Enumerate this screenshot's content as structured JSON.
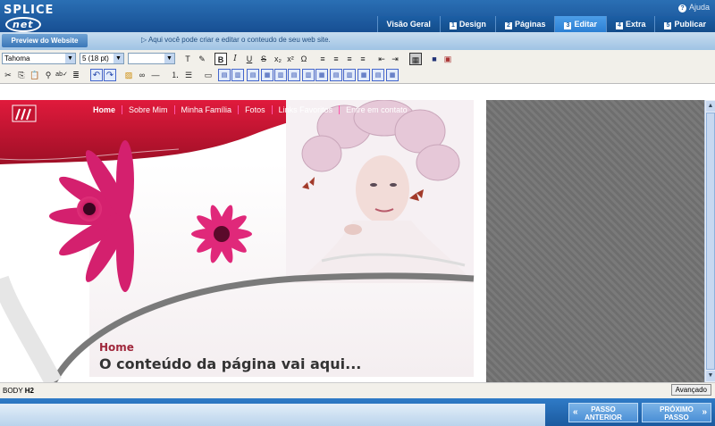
{
  "app": {
    "logo": "SPLICE",
    "logo_suffix": "net",
    "help_label": "Ajuda"
  },
  "tabs": [
    {
      "num": "",
      "label": "Visão Geral"
    },
    {
      "num": "1",
      "label": "Design"
    },
    {
      "num": "2",
      "label": "Páginas"
    },
    {
      "num": "3",
      "label": "Editar"
    },
    {
      "num": "4",
      "label": "Extra"
    },
    {
      "num": "5",
      "label": "Publicar"
    }
  ],
  "subbar": {
    "preview_label": "Preview do Website",
    "info_text": "Aqui você pode criar e editar o conteudo de seu web site."
  },
  "toolbar": {
    "font": "Tahoma",
    "size": "5 (18 pt)",
    "style": ""
  },
  "site": {
    "nav": [
      "Home",
      "Sobre Mim",
      "Minha Família",
      "Fotos",
      "Links Favoritos",
      "Entre em contato"
    ],
    "heading_small": "Home",
    "heading_big": "O conteúdo da página vai aqui..."
  },
  "statusbar": {
    "path_prefix": "BODY",
    "path_tag": "H2",
    "advanced_label": "Avançado"
  },
  "footer": {
    "prev_label_1": "PASSO",
    "prev_label_2": "ANTERIOR",
    "next_label_1": "PRÓXIMO",
    "next_label_2": "PASSO"
  },
  "colors": {
    "accent": "#c8102e",
    "brand_blue": "#1b5a9f",
    "heading_red": "#a0283c"
  }
}
